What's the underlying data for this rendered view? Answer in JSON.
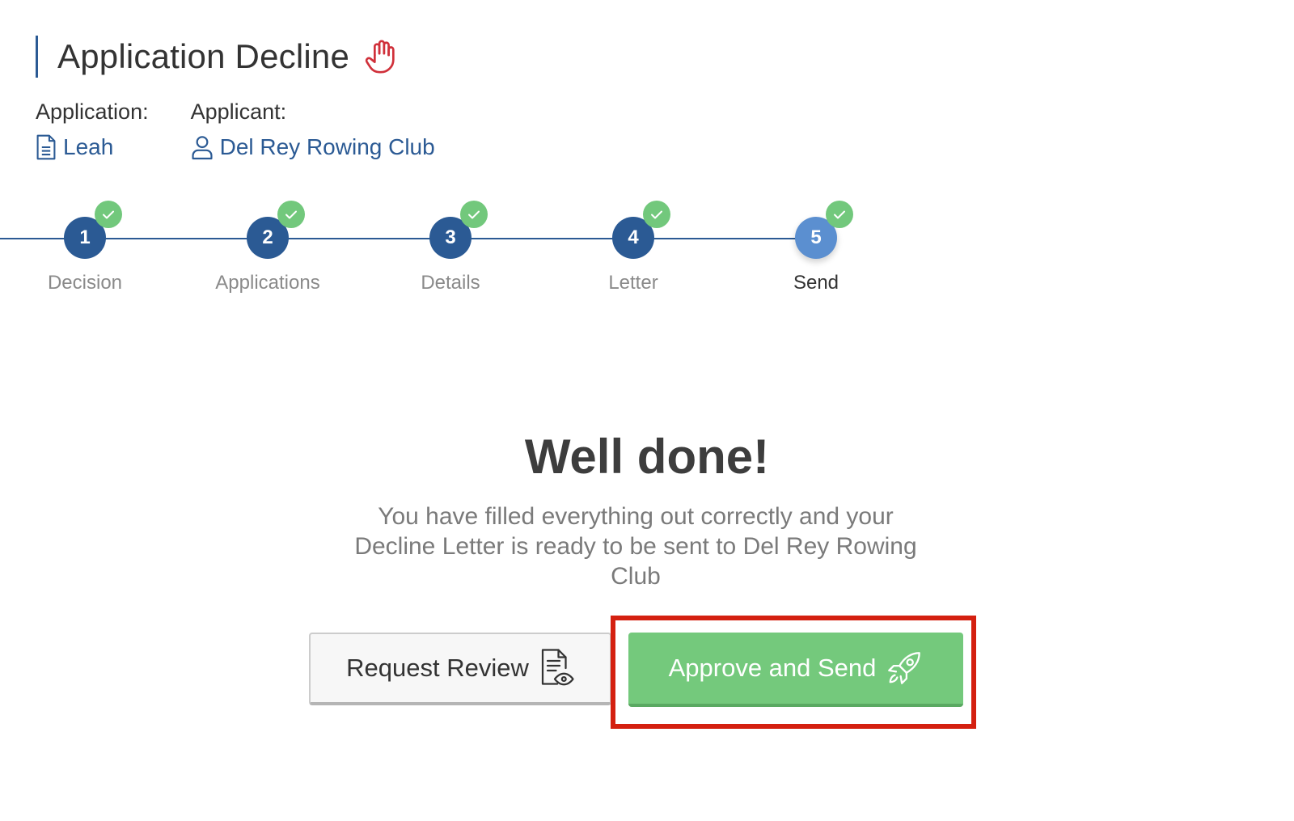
{
  "header": {
    "title": "Application Decline",
    "title_icon": "hand-stop-icon",
    "accent_color": "#2b5a94",
    "icon_color": "#d0303a"
  },
  "meta": {
    "application_label": "Application:",
    "application_value": "Leah",
    "application_icon": "document-icon",
    "applicant_label": "Applicant:",
    "applicant_value": "Del Rey Rowing Club",
    "applicant_icon": "user-icon"
  },
  "stepper": {
    "steps": [
      {
        "number": "1",
        "label": "Decision",
        "completed": true
      },
      {
        "number": "2",
        "label": "Applications",
        "completed": true
      },
      {
        "number": "3",
        "label": "Details",
        "completed": true
      },
      {
        "number": "4",
        "label": "Letter",
        "completed": true
      },
      {
        "number": "5",
        "label": "Send",
        "completed": true,
        "current": true
      }
    ],
    "check_color": "#72c87c",
    "step_color": "#2b5a94",
    "current_step_color": "#5b8fd0"
  },
  "content": {
    "title": "Well done!",
    "message": "You have filled everything out correctly and your Decline Letter is ready to be sent to Del Rey Rowing Club"
  },
  "actions": {
    "review_label": "Request Review",
    "review_icon": "document-eye-icon",
    "approve_label": "Approve and Send",
    "approve_icon": "rocket-icon",
    "approve_color": "#74c97c",
    "highlight_color": "#d42010"
  }
}
